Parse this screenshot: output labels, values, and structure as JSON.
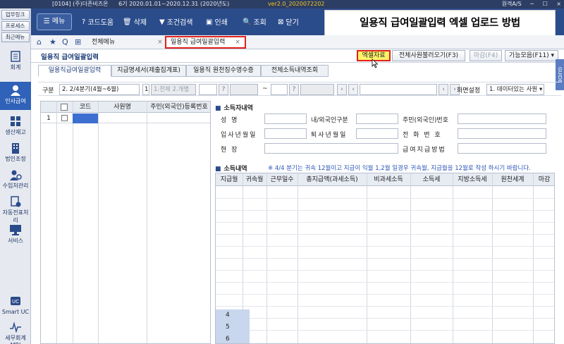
{
  "titlebar": {
    "company": "[0104] (주)더존비즈온",
    "period": "6기  2020.01.01~2020.12.31 (2020년도)",
    "version": "ver2.0_2020072202",
    "remote": "원격A/S",
    "controls": [
      "─",
      "☐",
      "×"
    ]
  },
  "sidebar": {
    "top_buttons": [
      "업무링크",
      "프로세스",
      "최근메뉴"
    ],
    "items": [
      {
        "label": "회계",
        "icon": "ledger-icon"
      },
      {
        "label": "인사급여",
        "icon": "person-icon",
        "active": true
      },
      {
        "label": "생산재고",
        "icon": "grid-icon"
      },
      {
        "label": "법인조정",
        "icon": "building-icon"
      },
      {
        "label": "수입처관리",
        "icon": "person-gear-icon"
      },
      {
        "label": "자동전표처리",
        "icon": "auto-icon"
      },
      {
        "label": "서비스",
        "icon": "monitor-icon"
      },
      {
        "label": "Smart UC",
        "icon": "uc-icon"
      },
      {
        "label": "세무회계MRI",
        "icon": "mri-icon"
      }
    ]
  },
  "toolbar": {
    "menu": "메뉴",
    "buttons": [
      "코드도움",
      "삭제",
      "조건검색",
      "인쇄",
      "조회",
      "닫기"
    ],
    "callout": "일용직 급여일괄입력 엑셀 업로드 방법"
  },
  "tabbar": {
    "tabs": [
      "전체메뉴",
      "일용직 급여일괄입력"
    ],
    "close": "×"
  },
  "page": {
    "title": "일용직 급여일괄입력",
    "header_buttons": [
      "엑셀자료",
      "전체사원불러오기(F3)",
      "마감(F4)",
      "기능모음(F11) ▾"
    ],
    "guide": "GUIDE",
    "sub_tabs": [
      "일용직급여일괄입력",
      "지급명세서(제출집계표)",
      "일용직 원천징수영수증",
      "전체소득내역조회"
    ]
  },
  "filter": {
    "label_quarter": "구분",
    "quarter_value": "2. 2/4분기(4월~6월)",
    "num_value": "1",
    "type_value": "1.전체 2.개별",
    "q1": "?",
    "tilde": "~",
    "q2": "?",
    "nav": [
      "‹",
      "‹",
      "›",
      "›"
    ],
    "screen_label": "화면설정",
    "screen_value": "1. 데이터있는 사원 ▾"
  },
  "left_grid": {
    "headers": [
      "",
      "코드",
      "사원명",
      "주민(외국인)등록번호"
    ],
    "row_num": "1"
  },
  "income_info": {
    "title": "소득자내역",
    "labels": [
      "성    명",
      "내/외국인구분",
      "주민(외국인)번호",
      "입사년월일",
      "퇴사년월일",
      "전 화 번 호",
      "현    장",
      "급여지급방법"
    ]
  },
  "income_detail": {
    "title": "소득내역",
    "notice": "※ 4/4 분기는 귀속 12월이고 지급이 익월 1,2월 일경우 귀속월, 지급월을 12월로 작성 하시기 바랍니다.",
    "headers": [
      "지급월",
      "귀속월",
      "근무일수",
      "총지급액(과세소득)",
      "비과세소득",
      "소득세",
      "지방소득세",
      "원천세계",
      "마감"
    ],
    "row_numbers": [
      "4",
      "5",
      "6"
    ]
  }
}
